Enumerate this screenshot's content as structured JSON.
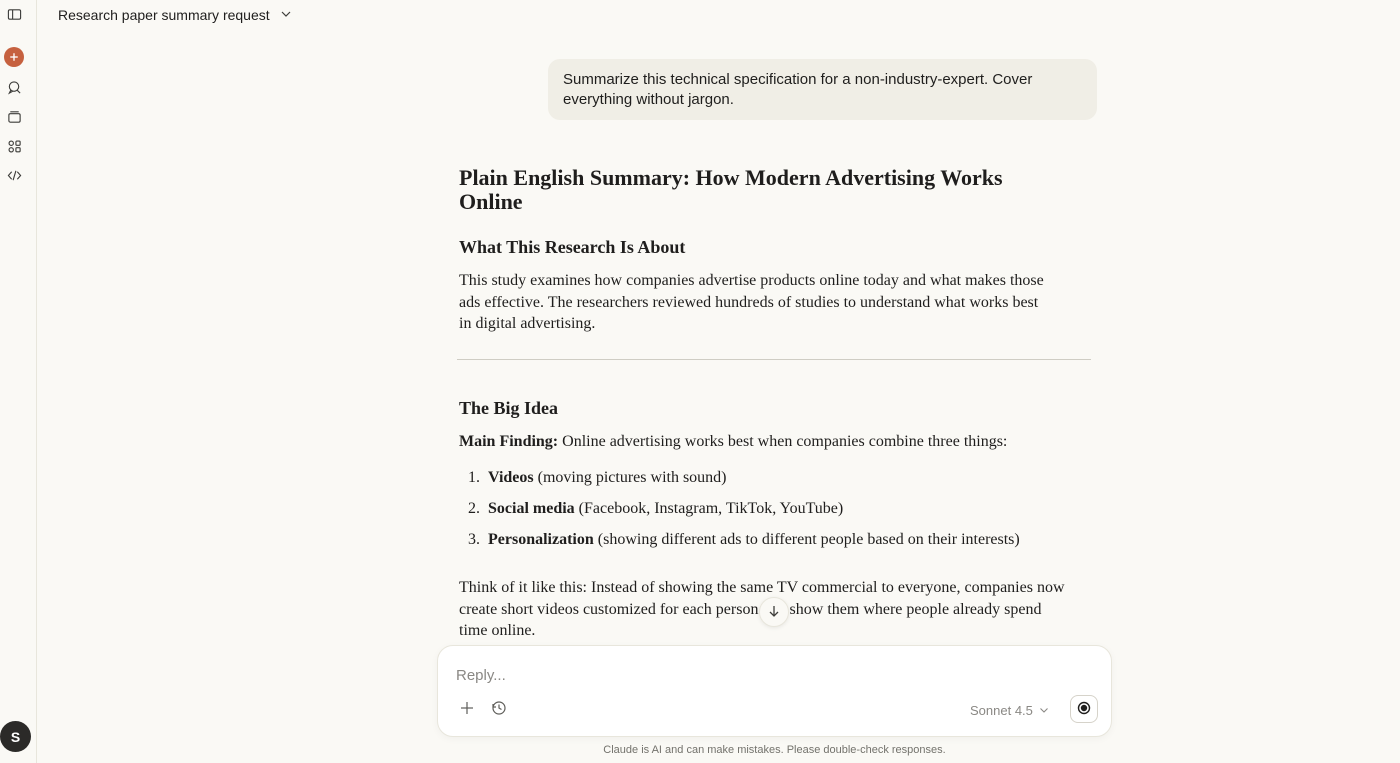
{
  "header": {
    "title": "Research paper summary request"
  },
  "sidebar": {
    "avatar_initial": "S",
    "icons": [
      "sidebar-toggle-icon",
      "new-chat-icon",
      "chats-icon",
      "projects-icon",
      "artifacts-icon",
      "code-icon"
    ]
  },
  "conversation": {
    "user_message": "Summarize this technical specification for a non-industry-expert. Cover everything without jargon.",
    "response": {
      "title": "Plain English Summary: How Modern Advertising Works Online",
      "section1_heading": "What This Research Is About",
      "section1_text": "This study examines how companies advertise products online today and what makes those ads effective. The researchers reviewed hundreds of studies to understand what works best in digital advertising.",
      "section2_heading": "The Big Idea",
      "main_finding_label": "Main Finding:",
      "main_finding_text": " Online advertising works best when companies combine three things:",
      "list": [
        {
          "num": "1.",
          "bold": "Videos",
          "rest": " (moving pictures with sound)"
        },
        {
          "num": "2.",
          "bold": "Social media",
          "rest": " (Facebook, Instagram, TikTok, YouTube)"
        },
        {
          "num": "3.",
          "bold": "Personalization",
          "rest": " (showing different ads to different people based on their interests)"
        }
      ],
      "closing_text": "Think of it like this: Instead of showing the same TV commercial to everyone, companies now create short videos customized for each person and show them where people already spend time online."
    }
  },
  "composer": {
    "placeholder": "Reply...",
    "model": "Sonnet 4.5"
  },
  "footer": {
    "disclaimer": "Claude is AI and can make mistakes. Please double-check responses."
  }
}
